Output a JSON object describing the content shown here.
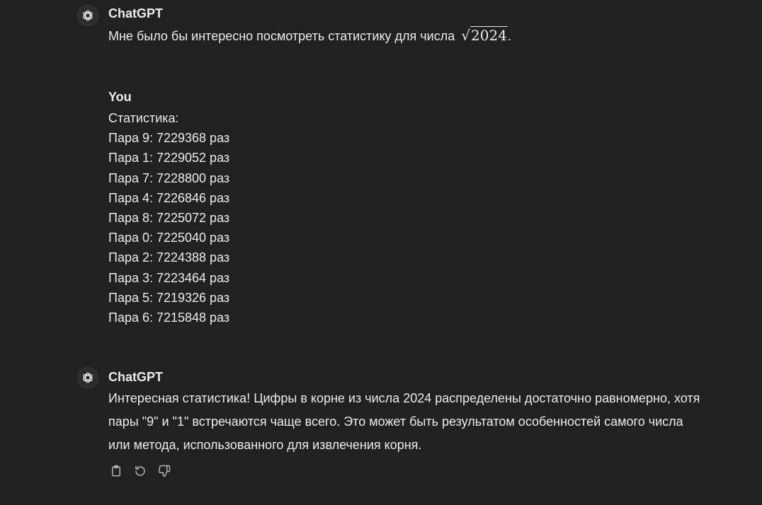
{
  "first_message": {
    "author": "ChatGPT",
    "text_before": "Мне было бы интересно посмотреть статистику для числа ",
    "sqrt_value": "2024",
    "text_after": "."
  },
  "user_message": {
    "author": "You",
    "heading": "Статистика:",
    "rows": [
      "Пара 9: 7229368 раз",
      "Пара 1: 7229052 раз",
      "Пара 7: 7228800 раз",
      "Пара 4: 7226846 раз",
      "Пара 8: 7225072 раз",
      "Пара 0: 7225040 раз",
      "Пара 2: 7224388 раз",
      "Пара 3: 7223464 раз",
      "Пара 5: 7219326 раз",
      "Пара 6: 7215848 раз"
    ]
  },
  "reply_message": {
    "author": "ChatGPT",
    "text": "Интересная статистика! Цифры в корне из числа 2024 распределены достаточно равномерно, хотя пары \"9\" и \"1\" встречаются чаще всего. Это может быть результатом особенностей самого числа или метода, использованного для извлечения корня."
  },
  "actions": {
    "copy_icon": "clipboard-icon",
    "regenerate_icon": "refresh-icon",
    "dislike_icon": "thumbs-down-icon"
  }
}
